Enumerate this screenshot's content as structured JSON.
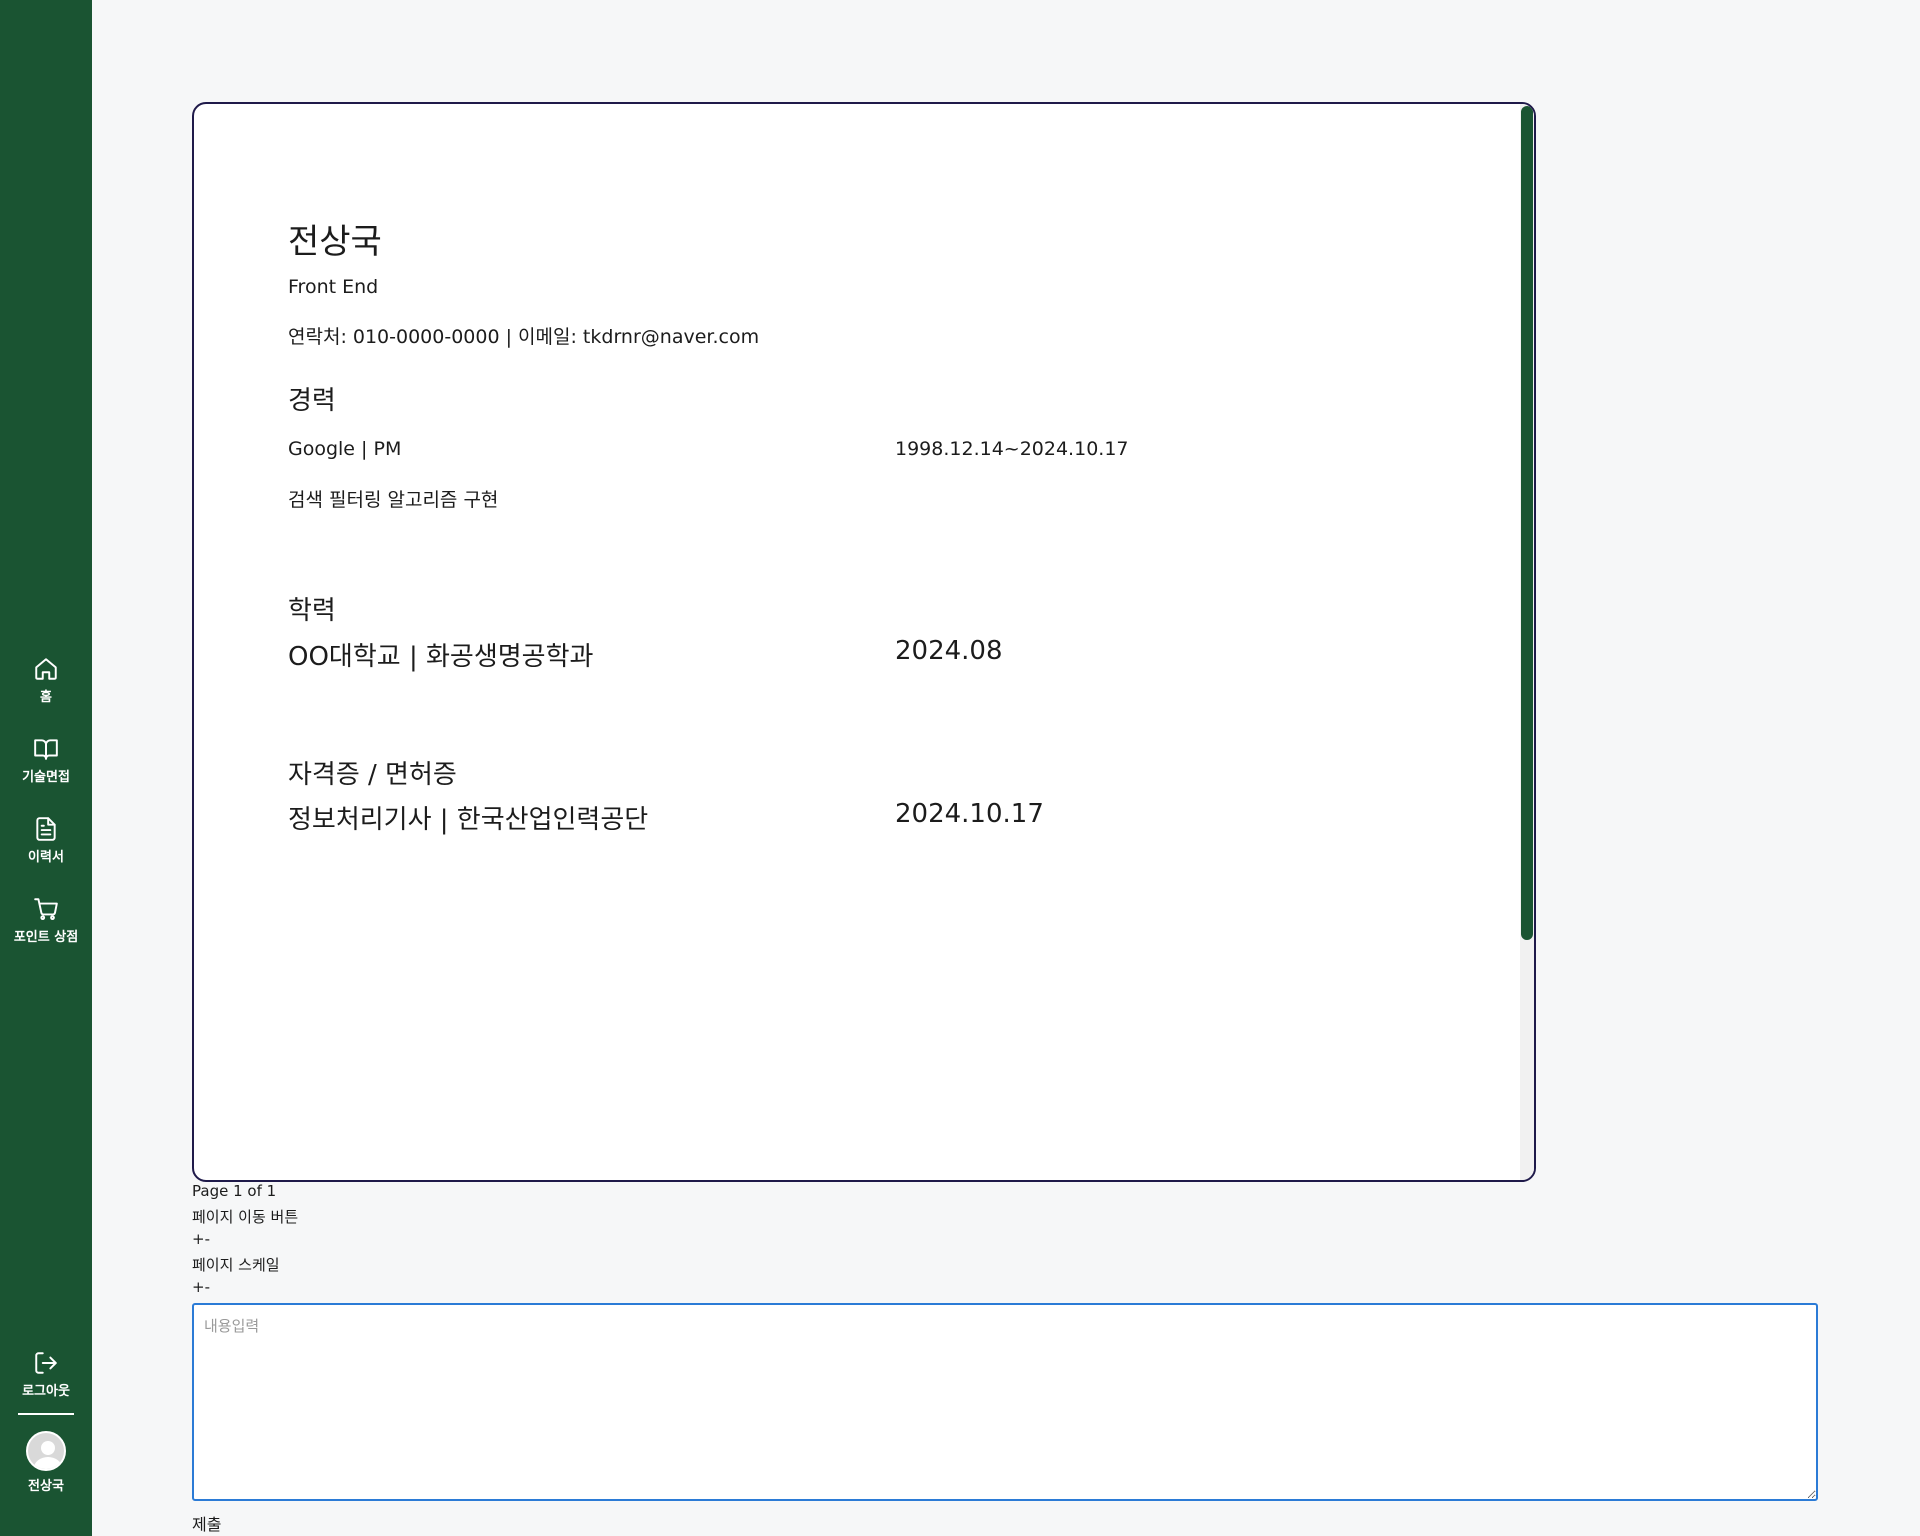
{
  "sidebar": {
    "items": [
      {
        "label": "홈",
        "icon": "home-icon"
      },
      {
        "label": "기술면접",
        "icon": "book-icon"
      },
      {
        "label": "이력서",
        "icon": "document-icon"
      },
      {
        "label": "포인트 상점",
        "icon": "cart-icon"
      }
    ],
    "logout": {
      "label": "로그아웃",
      "icon": "logout-icon"
    },
    "user": {
      "name": "전상국",
      "icon": "avatar-icon"
    }
  },
  "resume": {
    "name": "전상국",
    "role": "Front End",
    "contact": "연락처: 010-0000-0000 | 이메일: tkdrnr@naver.com",
    "career": {
      "heading": "경력",
      "company": "Google | PM",
      "period": "1998.12.14~2024.10.17",
      "description": "검색 필터링 알고리즘 구현"
    },
    "education": {
      "heading": "학력",
      "school": "OO대학교 | 화공생명공학과",
      "date": "2024.08"
    },
    "certificates": {
      "heading": "자격증 / 면허증",
      "name": "정보처리기사 | 한국산업인력공단",
      "date": "2024.10.17"
    }
  },
  "pager": {
    "page_info": "Page 1 of 1",
    "nav_label": "페이지 이동 버튼",
    "nav_controls": "+-",
    "scale_label": "페이지 스케일",
    "scale_controls": "+-"
  },
  "comment": {
    "placeholder": "내용입력",
    "value": "",
    "submit_label": "제출"
  },
  "colors": {
    "sidebar_bg": "#1a5432",
    "page_bg": "#f6f7f8",
    "viewer_border": "#1f1a4a",
    "input_border": "#2b7bd6"
  }
}
